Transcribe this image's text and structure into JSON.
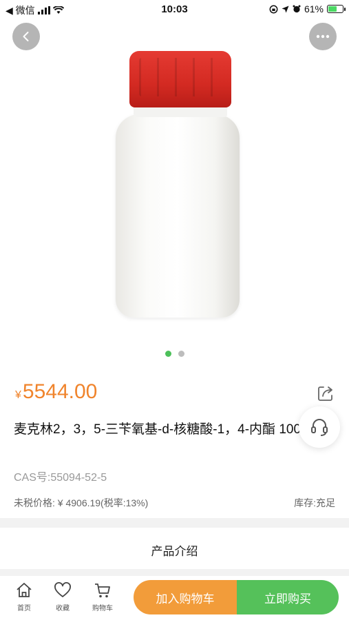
{
  "status_bar": {
    "back_app": "◀ 微信",
    "time": "10:03",
    "battery_text": "61%",
    "battery_level": 0.61
  },
  "product": {
    "currency": "¥",
    "price": "5544.00",
    "title": "麦克林2，3，5-三苄氧基-d-核糖酸-1，4-内酯 100g",
    "cas": "CAS号:55094-52-5",
    "tax_price": "未税价格: ¥ 4906.19(税率:13%)",
    "stock": "库存:充足",
    "image_count": 2,
    "active_image": 1
  },
  "section": {
    "intro_title": "产品介绍"
  },
  "bottom_bar": {
    "home_label": "首页",
    "fav_label": "收藏",
    "cart_label": "购物车",
    "add_to_cart": "加入购物车",
    "buy_now": "立即购买"
  },
  "colors": {
    "price": "#f0842c",
    "cart_button": "#f29c3a",
    "buy_button": "#55c15a",
    "active_dot": "#4cc05a",
    "cap": "#d32a22"
  },
  "icons": [
    "back-icon",
    "more-icon",
    "share-icon",
    "headset-icon",
    "home-icon",
    "heart-icon",
    "cart-icon"
  ]
}
